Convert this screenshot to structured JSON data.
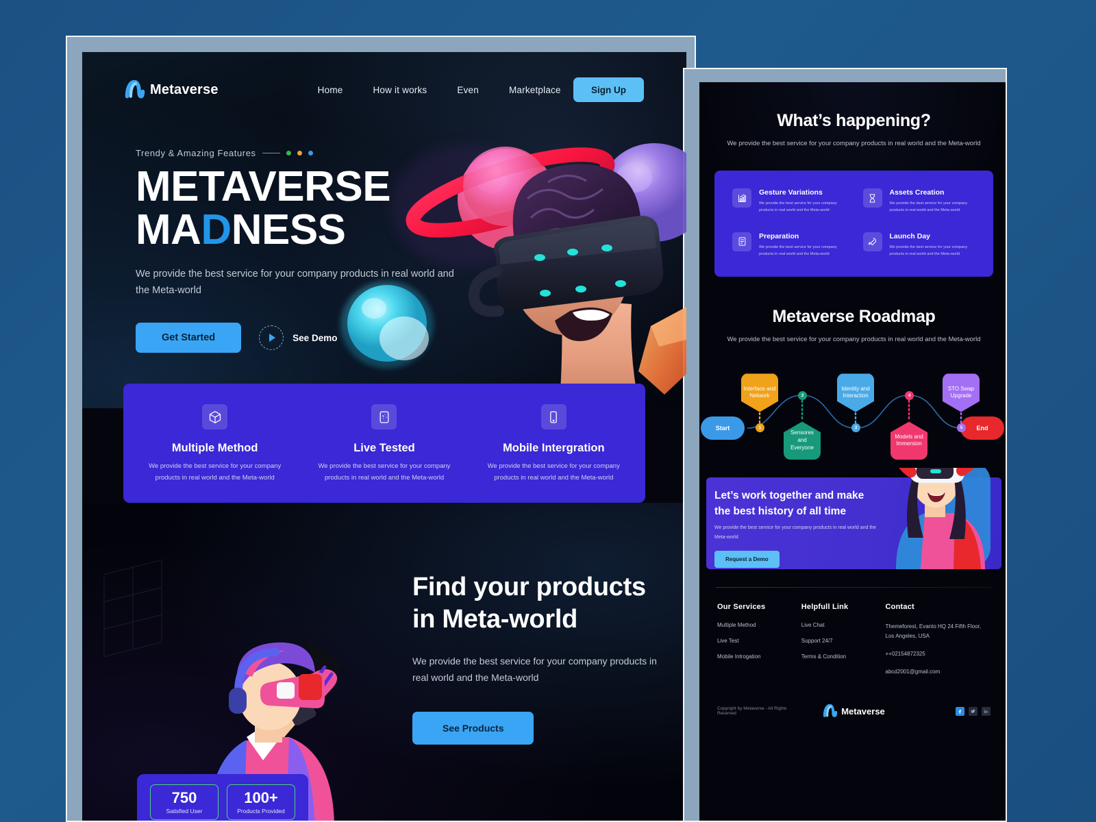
{
  "brand": {
    "name": "Metaverse",
    "accent": "#3aa5f5",
    "accent_light": "#5cc0f7",
    "purple": "#3b28d6",
    "green": "#4fd17a"
  },
  "left_page": {
    "nav": {
      "logo_text": "Metaverse",
      "links": [
        "Home",
        "How it works",
        "Even",
        "Marketplace"
      ],
      "signup_label": "Sign Up"
    },
    "hero": {
      "eyebrow": "Trendy & Amazing Features",
      "eyebrow_dots": [
        "#3bb54a",
        "#e8a33d",
        "#3a9ae8"
      ],
      "title_line1": "METAVERSE",
      "title_line2_pre": "MA",
      "title_line2_accent": "D",
      "title_line2_post": "NESS",
      "subtitle": "We provide the best service for your company products in real world and the Meta-world",
      "primary_cta": "Get Started",
      "secondary_cta": "See Demo"
    },
    "features": [
      {
        "icon": "cube-icon",
        "title": "Multiple Method",
        "desc": "We provide the best service for your company products in real world and the Meta-world"
      },
      {
        "icon": "sparkle-card-icon",
        "title": "Live Tested",
        "desc": "We provide the best service for your company products in real world and the Meta-world"
      },
      {
        "icon": "mobile-icon",
        "title": "Mobile Intergration",
        "desc": "We provide the best service for your company products in real world and the Meta-world"
      }
    ],
    "find_section": {
      "title_line1": "Find your products",
      "title_line2": "in Meta-world",
      "subtitle": "We provide the best service for your company products in real world and the Meta-world",
      "cta": "See Products"
    },
    "stats": [
      {
        "number": "750",
        "label": "Satisfied User"
      },
      {
        "number": "100+",
        "label": "Products Provided"
      }
    ]
  },
  "right_page": {
    "happening": {
      "title": "What’s happening?",
      "subtitle": "We provide the best service for your company products in real world and the Meta-world",
      "cards": [
        {
          "icon": "bar-chart-icon",
          "title": "Gesture Variations",
          "desc": "We provide the best service for your company products in real world and the Meta-world"
        },
        {
          "icon": "hourglass-icon",
          "title": "Assets Creation",
          "desc": "We provide the best service for your company products in real world and the Meta-world"
        },
        {
          "icon": "document-icon",
          "title": "Preparation",
          "desc": "We provide the best service for your company products in real world and the Meta-world"
        },
        {
          "icon": "rocket-icon",
          "title": "Launch Day",
          "desc": "We provide the best service for your company products in real world and the Meta-world"
        }
      ]
    },
    "roadmap": {
      "title": "Metaverse Roadmap",
      "subtitle": "We provide the best service for your company products in real world and the Meta-world",
      "start_label": "Start",
      "end_label": "End",
      "steps": [
        {
          "number": "1",
          "label": "Interface and Network",
          "color": "#f0a21b",
          "position": "up"
        },
        {
          "number": "2",
          "label": "Sensores and Everyone",
          "color": "#17997a",
          "position": "down"
        },
        {
          "number": "3",
          "label": "Identity and Interaction",
          "color": "#4aaae8",
          "position": "up"
        },
        {
          "number": "4",
          "label": "Models and Immersion",
          "color": "#f1386e",
          "position": "down"
        },
        {
          "number": "5",
          "label": "STO Swap Upgrade",
          "color": "#a36ff5",
          "position": "up"
        }
      ],
      "start_color": "#3a9ae8",
      "end_color": "#e8282c"
    },
    "cta": {
      "title_line1": "Let’s work together and make",
      "title_line2": "the best history of all time",
      "subtitle": "We provide the best service for your company products in real world and the Meta-world",
      "button": "Request a Demo"
    },
    "footer": {
      "columns": [
        {
          "heading": "Our Services",
          "items": [
            "Multiple Method",
            "Live Test",
            "Mobile Introgation"
          ]
        },
        {
          "heading": "Helpfull Link",
          "items": [
            "Live Chat",
            "Support 24/7",
            "Terms &  Condition"
          ]
        }
      ],
      "contact": {
        "heading": "Contact",
        "address": "Themeforest, Evanto HQ 24 Fifth Floor, Los Angeles, USA",
        "phone": "++02154872325",
        "email": "abcd2001@gmail.com"
      },
      "copyright": "Copyright by Metaverse - All Rights Reserved",
      "logo_text": "Metaverse",
      "socials": [
        "facebook-icon",
        "twitter-icon",
        "linkedin-icon"
      ]
    }
  }
}
